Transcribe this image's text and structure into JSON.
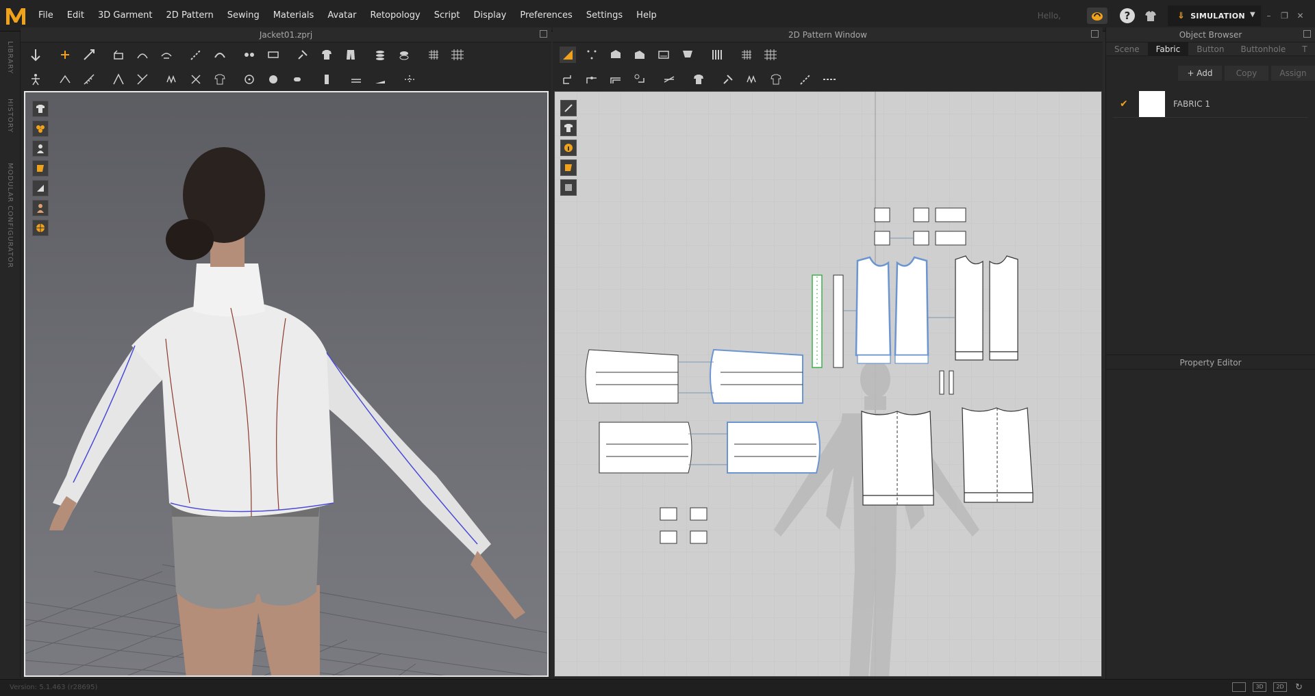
{
  "menubar": {
    "items": [
      "File",
      "Edit",
      "3D Garment",
      "2D Pattern",
      "Sewing",
      "Materials",
      "Avatar",
      "Retopology",
      "Script",
      "Display",
      "Preferences",
      "Settings",
      "Help"
    ],
    "hello": "Hello,",
    "mode": "SIMULATION",
    "accent_color": "#f0a21a"
  },
  "left_tabs": [
    "LIBRARY",
    "HISTORY",
    "MODULAR CONFIGURATOR"
  ],
  "window3d": {
    "title": "Jacket01.zprj"
  },
  "window2d": {
    "title": "2D Pattern Window"
  },
  "object_browser": {
    "title": "Object Browser",
    "tabs": [
      "Scene",
      "Fabric",
      "Button",
      "Buttonhole",
      "T"
    ],
    "active_tab": "Fabric",
    "actions": {
      "add": "+ Add",
      "copy": "Copy",
      "assign": "Assign"
    },
    "fabrics": [
      {
        "name": "FABRIC 1",
        "checked": true
      }
    ]
  },
  "property_editor": {
    "title": "Property Editor"
  },
  "status": {
    "version": "Version: 5.1.463 (r28695)",
    "layouts": [
      "",
      "3D",
      "2D"
    ]
  }
}
